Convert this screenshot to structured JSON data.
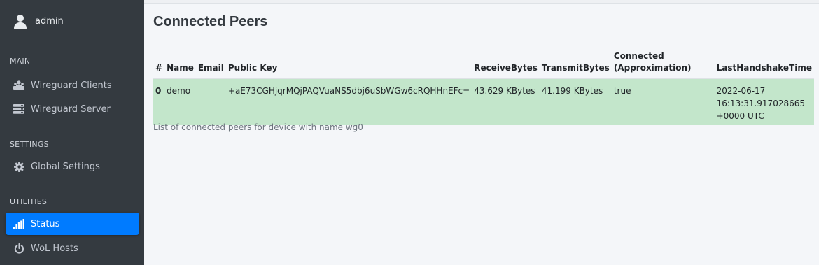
{
  "sidebar": {
    "user": {
      "name": "admin"
    },
    "sections": [
      {
        "header": "MAIN",
        "items": [
          {
            "label": "Wireguard Clients",
            "icon": "users-icon"
          },
          {
            "label": "Wireguard Server",
            "icon": "server-icon"
          }
        ]
      },
      {
        "header": "SETTINGS",
        "items": [
          {
            "label": "Global Settings",
            "icon": "gear-icon"
          }
        ]
      },
      {
        "header": "UTILITIES",
        "items": [
          {
            "label": "Status",
            "icon": "signal-icon",
            "active": true
          },
          {
            "label": "WoL Hosts",
            "icon": "power-icon"
          }
        ]
      }
    ]
  },
  "main": {
    "title": "Connected Peers",
    "table": {
      "headers": {
        "index": "#",
        "name": "Name",
        "email": "Email",
        "public_key": "Public Key",
        "receive_bytes": "ReceiveBytes",
        "transmit_bytes": "TransmitBytes",
        "connected_line1": "Connected",
        "connected_line2": "(Approximation)",
        "last_handshake": "LastHandshakeTime"
      },
      "rows": [
        {
          "index": "0",
          "name": "demo",
          "email": "",
          "public_key": "+aE73CGHjqrMQjPAQVuaNS5dbj6uSbWGw6cRQHHnEFc=",
          "receive_bytes": "43.629 KBytes",
          "transmit_bytes": "41.199 KBytes",
          "connected": "true",
          "last_handshake_line1": "2022-06-17 16:13:31.917028665",
          "last_handshake_line2": "+0000 UTC"
        }
      ]
    },
    "caption": "List of connected peers for device with name wg0"
  },
  "colors": {
    "sidebar_bg": "#343a40",
    "active_item": "#007bff",
    "row_success": "#c3e6cb",
    "page_bg": "#f4f6f9"
  }
}
